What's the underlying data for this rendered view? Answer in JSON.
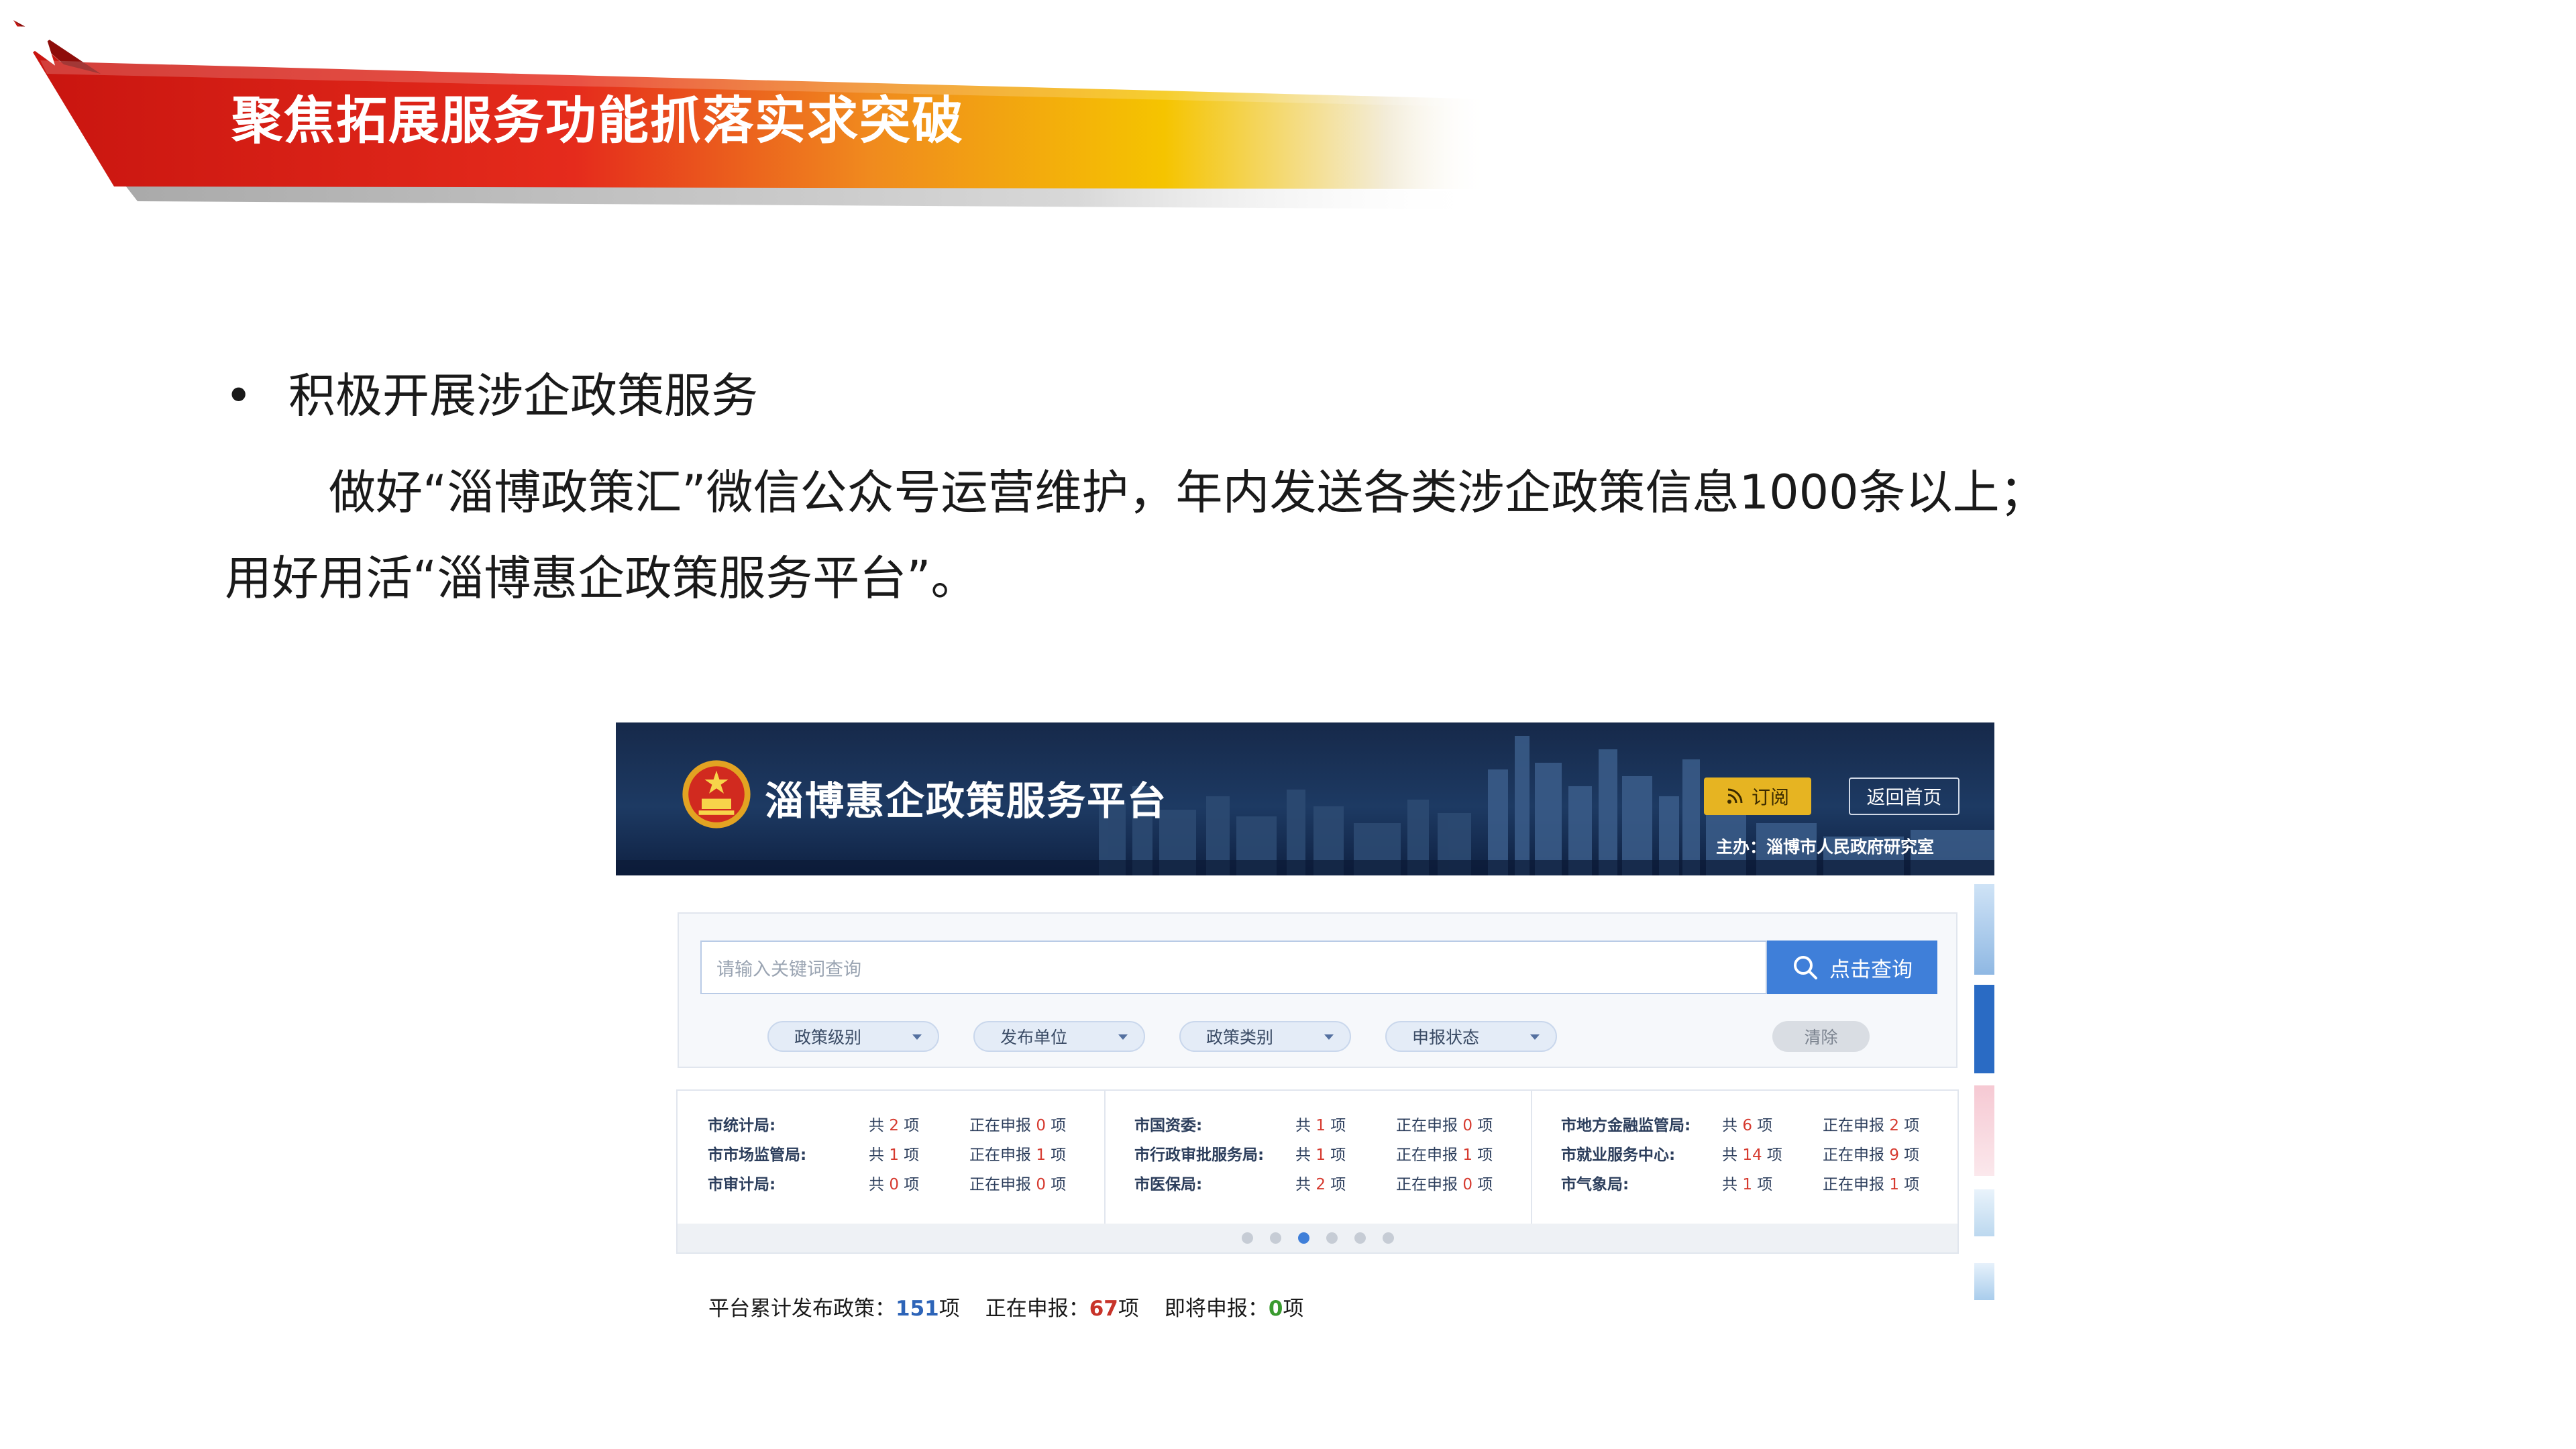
{
  "banner": {
    "title": "聚焦拓展服务功能抓落实求突破",
    "icon": "star-icon",
    "colors": {
      "red": "#d9211d",
      "dark_red": "#b51613",
      "orange": "#f39a1c",
      "yellow": "#f5c400"
    }
  },
  "content": {
    "bullet_symbol": "•",
    "bullet_title": "积极开展涉企政策服务",
    "paragraph_line1": "做好“淄博政策汇”微信公众号运营维护，年内发送各类涉企政策信息1000条以上；",
    "paragraph_line2": "用好用活“淄博惠企政策服务平台”。"
  },
  "platform": {
    "title": "淄博惠企政策服务平台",
    "subscribe_label": "订阅",
    "home_label": "返回首页",
    "host_label": "主办：淄博市人民政府研究室",
    "search_placeholder": "请输入关键词查询",
    "search_button": "点击查询",
    "filters": [
      "政策级别",
      "发布单位",
      "政策类别",
      "申报状态"
    ],
    "clear_label": "清除",
    "departments": [
      [
        {
          "name": "市统计局:",
          "total_pre": "共",
          "total": "2",
          "total_suf": "项",
          "open_pre": "正在申报",
          "open": "0",
          "open_suf": "项"
        },
        {
          "name": "市市场监管局:",
          "total_pre": "共",
          "total": "1",
          "total_suf": "项",
          "open_pre": "正在申报",
          "open": "1",
          "open_suf": "项"
        },
        {
          "name": "市审计局:",
          "total_pre": "共",
          "total": "0",
          "total_suf": "项",
          "open_pre": "正在申报",
          "open": "0",
          "open_suf": "项"
        }
      ],
      [
        {
          "name": "市国资委:",
          "total_pre": "共",
          "total": "1",
          "total_suf": "项",
          "open_pre": "正在申报",
          "open": "0",
          "open_suf": "项"
        },
        {
          "name": "市行政审批服务局:",
          "total_pre": "共",
          "total": "1",
          "total_suf": "项",
          "open_pre": "正在申报",
          "open": "1",
          "open_suf": "项"
        },
        {
          "name": "市医保局:",
          "total_pre": "共",
          "total": "2",
          "total_suf": "项",
          "open_pre": "正在申报",
          "open": "0",
          "open_suf": "项"
        }
      ],
      [
        {
          "name": "市地方金融监管局:",
          "total_pre": "共",
          "total": "6",
          "total_suf": "项",
          "open_pre": "正在申报",
          "open": "2",
          "open_suf": "项"
        },
        {
          "name": "市就业服务中心:",
          "total_pre": "共",
          "total": "14",
          "total_suf": "项",
          "open_pre": "正在申报",
          "open": "9",
          "open_suf": "项"
        },
        {
          "name": "市气象局:",
          "total_pre": "共",
          "total": "1",
          "total_suf": "项",
          "open_pre": "正在申报",
          "open": "1",
          "open_suf": "项"
        }
      ]
    ],
    "carousel": {
      "count": 6,
      "active_index": 2
    },
    "totals": {
      "published_label": "平台累计发布政策：",
      "published_value": "151",
      "published_unit": "项",
      "open_label": "正在申报：",
      "open_value": "67",
      "open_unit": "项",
      "upcoming_label": "即将申报：",
      "upcoming_value": "0",
      "upcoming_unit": "项"
    },
    "colors": {
      "header_bg": "#1d3a63",
      "accent_blue": "#3f7fd9",
      "subscribe_yellow": "#e6b422",
      "value_red": "#d63a2f",
      "value_green": "#3a9b2f"
    }
  }
}
